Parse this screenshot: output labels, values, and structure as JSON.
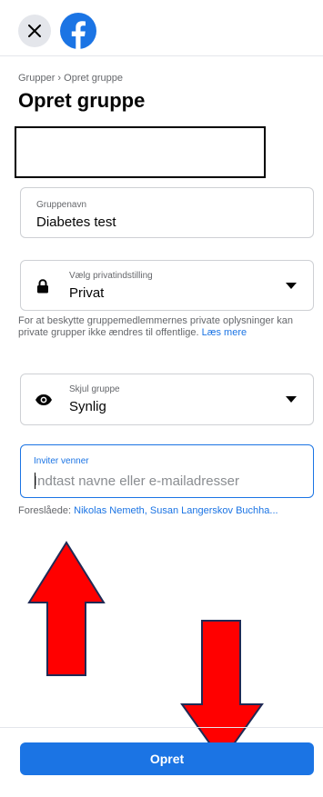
{
  "topbar": {
    "close_icon": "close-icon",
    "logo_icon": "facebook-logo-icon",
    "brand_color": "#1b74e4"
  },
  "breadcrumb": {
    "parent": "Grupper",
    "separator": "›",
    "current": "Opret gruppe"
  },
  "page_title": "Opret gruppe",
  "form": {
    "group_name": {
      "label": "Gruppenavn",
      "value": "Diabetes test"
    },
    "privacy": {
      "label": "Vælg privatindstilling",
      "value": "Privat",
      "icon": "lock-icon"
    },
    "privacy_helper": {
      "text": "For at beskytte gruppemedlemmernes private oplysninger kan private grupper ikke ændres til offentlige.",
      "link": "Læs mere"
    },
    "hide_group": {
      "label": "Skjul gruppe",
      "value": "Synlig",
      "icon": "eye-icon"
    },
    "invite": {
      "label": "Inviter venner",
      "placeholder": "Indtast navne eller e-mailadresser"
    },
    "suggestions": {
      "prefix": "Foreslåede:",
      "names": "Nikolas Nemeth, Susan Langerskov Buchha..."
    }
  },
  "annotations": {
    "arrow_color": "#ff0000"
  },
  "submit": {
    "label": "Opret"
  }
}
